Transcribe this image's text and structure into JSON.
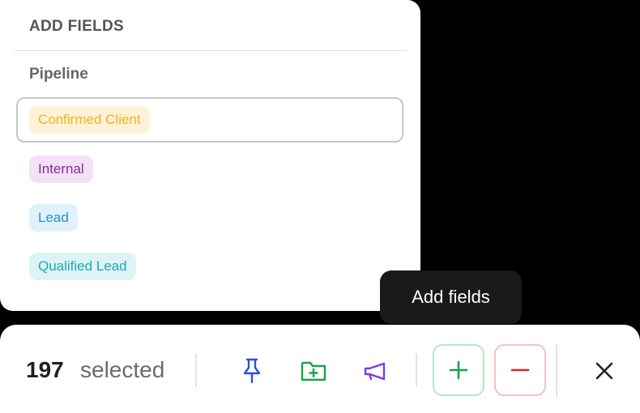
{
  "panel": {
    "header": "ADD FIELDS",
    "section_title": "Pipeline",
    "options": [
      {
        "label": "Confirmed Client",
        "text_color": "#f0b41e",
        "bg": "#fff2d8",
        "selected": true
      },
      {
        "label": "Internal",
        "text_color": "#8a2a9a",
        "bg": "#f4e1f7",
        "selected": false
      },
      {
        "label": "Lead",
        "text_color": "#2a8fd0",
        "bg": "#e1f1fb",
        "selected": false
      },
      {
        "label": "Qualified Lead",
        "text_color": "#1fa9b3",
        "bg": "#ddf3f5",
        "selected": false
      }
    ]
  },
  "tooltip": {
    "text": "Add fields"
  },
  "toolbar": {
    "count": "197",
    "selected_label": "selected",
    "actions": [
      {
        "name": "pin-icon",
        "color": "#2f4fd6"
      },
      {
        "name": "folder-add-icon",
        "color": "#16a34a"
      },
      {
        "name": "megaphone-icon",
        "color": "#7c3aed"
      },
      {
        "name": "add-icon",
        "color": "#16a34a",
        "border": "#b6e6c3"
      },
      {
        "name": "remove-icon",
        "color": "#dc2626",
        "border": "#f5c2c2"
      },
      {
        "name": "close-icon",
        "color": "#222222"
      }
    ]
  }
}
